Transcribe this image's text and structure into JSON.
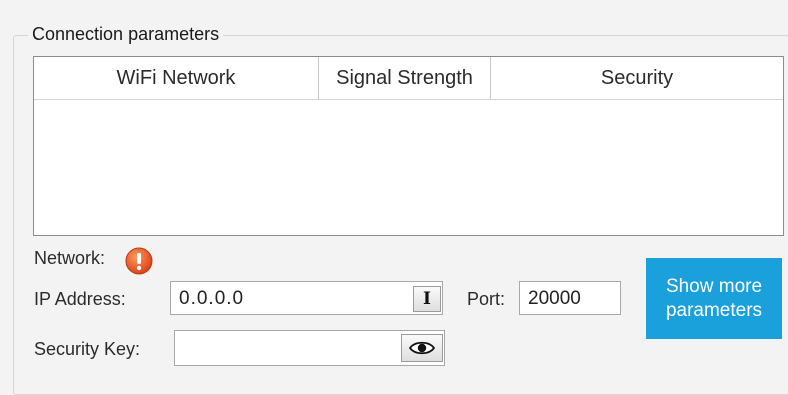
{
  "group": {
    "title": "Connection parameters"
  },
  "table": {
    "columns": [
      "WiFi Network",
      "Signal Strength",
      "Security"
    ],
    "rows": []
  },
  "network": {
    "label": "Network:",
    "status_icon": "error-alert-icon",
    "status_color": "#e8531f"
  },
  "ip": {
    "label": "IP Address:",
    "value": "0.0.0.0"
  },
  "port": {
    "label": "Port:",
    "value": "20000"
  },
  "security_key": {
    "label": "Security Key:",
    "value": ""
  },
  "show_more": {
    "label": "Show more\nparameters",
    "color": "#1aa0da"
  }
}
